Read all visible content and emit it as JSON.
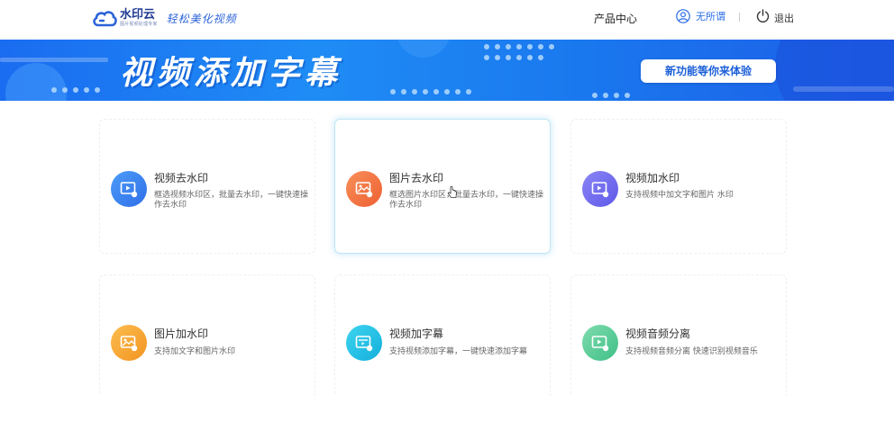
{
  "header": {
    "logo_name": "水印云",
    "logo_sub": "图片视频处理专家",
    "slogan": "轻松美化视频",
    "nav_products": "产品中心",
    "user_name": "无所谓",
    "logout_label": "退出"
  },
  "banner": {
    "title": "视频添加字幕",
    "button_label": "新功能等你来体验"
  },
  "tools": [
    {
      "title": "视频去水印",
      "desc": "框选视频水印区，批量去水印，一键快速操作去水印",
      "color": "#2f7df0",
      "icon": "video-icon"
    },
    {
      "title": "图片去水印",
      "desc": "框选图片水印区，批量去水印，一键快速操作去水印",
      "color": "#f26b3a",
      "icon": "image-icon"
    },
    {
      "title": "视频加水印",
      "desc": "支持视频中加文字和图片 水印",
      "color": "#6b67ef",
      "icon": "video-icon"
    },
    {
      "title": "图片加水印",
      "desc": "支持加文字和图片水印",
      "color": "#f7a531",
      "icon": "image-icon"
    },
    {
      "title": "视频加字幕",
      "desc": "支持视频添加字幕，一键快速添加字幕",
      "color": "#1dc2e6",
      "icon": "video-subtitle-icon"
    },
    {
      "title": "视频音频分离",
      "desc": "支持视频音频分离 快速识别视频音乐",
      "color": "#5ccf9a",
      "icon": "video-audio-icon"
    }
  ]
}
